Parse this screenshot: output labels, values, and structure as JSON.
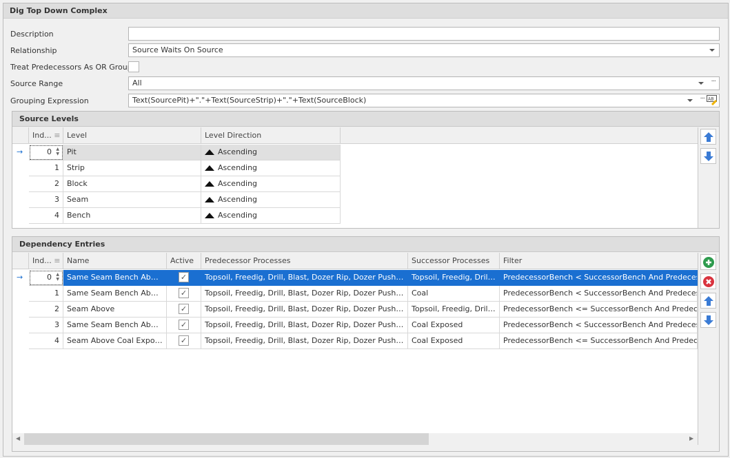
{
  "title": "Dig Top Down Complex",
  "form": {
    "description_label": "Description",
    "description_value": "",
    "relationship_label": "Relationship",
    "relationship_value": "Source Waits On Source",
    "or_group_label": "Treat Predecessors As OR Group",
    "or_group_checked": false,
    "source_range_label": "Source Range",
    "source_range_value": "All",
    "grouping_label": "Grouping Expression",
    "grouping_value": "Text(SourcePit)+\".\"+Text(SourceStrip)+\".\"+Text(SourceBlock)",
    "ellipsis": "···"
  },
  "source_levels": {
    "title": "Source Levels",
    "columns": [
      "Ind...",
      "Level",
      "Level Direction"
    ],
    "rows": [
      {
        "index": "0",
        "level": "Pit",
        "direction": "Ascending"
      },
      {
        "index": "1",
        "level": "Strip",
        "direction": "Ascending"
      },
      {
        "index": "2",
        "level": "Block",
        "direction": "Ascending"
      },
      {
        "index": "3",
        "level": "Seam",
        "direction": "Ascending"
      },
      {
        "index": "4",
        "level": "Bench",
        "direction": "Ascending"
      }
    ]
  },
  "dependency_entries": {
    "title": "Dependency Entries",
    "columns": [
      "Ind...",
      "Name",
      "Active",
      "Predecessor Processes",
      "Successor Processes",
      "Filter"
    ],
    "rows": [
      {
        "index": "0",
        "name": "Same Seam Bench Above...",
        "active": "✓",
        "pred": "Topsoil, Freedig, Drill, Blast, Dozer Rip, Dozer Push, Dragli...",
        "succ": "Topsoil, Freedig, Drill,...",
        "filter": "PredecessorBench < SuccessorBench And PredecessorSe..."
      },
      {
        "index": "1",
        "name": "Same Seam Bench Above...",
        "active": "✓",
        "pred": "Topsoil, Freedig, Drill, Blast, Dozer Rip, Dozer Push, Dragli...",
        "succ": "Coal",
        "filter": "PredecessorBench < SuccessorBench And PredecessorSe..."
      },
      {
        "index": "2",
        "name": "Seam Above",
        "active": "✓",
        "pred": "Topsoil, Freedig, Drill, Blast, Dozer Rip, Dozer Push, Dragli...",
        "succ": "Topsoil, Freedig, Drill,...",
        "filter": "PredecessorBench <= SuccessorBench And PredecessorS..."
      },
      {
        "index": "3",
        "name": "Same Seam Bench Above...",
        "active": "✓",
        "pred": "Topsoil, Freedig, Drill, Blast, Dozer Rip, Dozer Push, Dragli...",
        "succ": "Coal Exposed",
        "filter": "PredecessorBench < SuccessorBench And PredecessorSe..."
      },
      {
        "index": "4",
        "name": "Seam Above Coal Exposed",
        "active": "✓",
        "pred": "Topsoil, Freedig, Drill, Blast, Dozer Rip, Dozer Push, Dragli...",
        "succ": "Coal Exposed",
        "filter": "PredecessorBench <= SuccessorBench And PredecessorS..."
      }
    ]
  },
  "colors": {
    "selection": "#1a6fd1",
    "add": "#2e9b4e",
    "remove": "#d9343f",
    "move": "#3a7bd5"
  }
}
